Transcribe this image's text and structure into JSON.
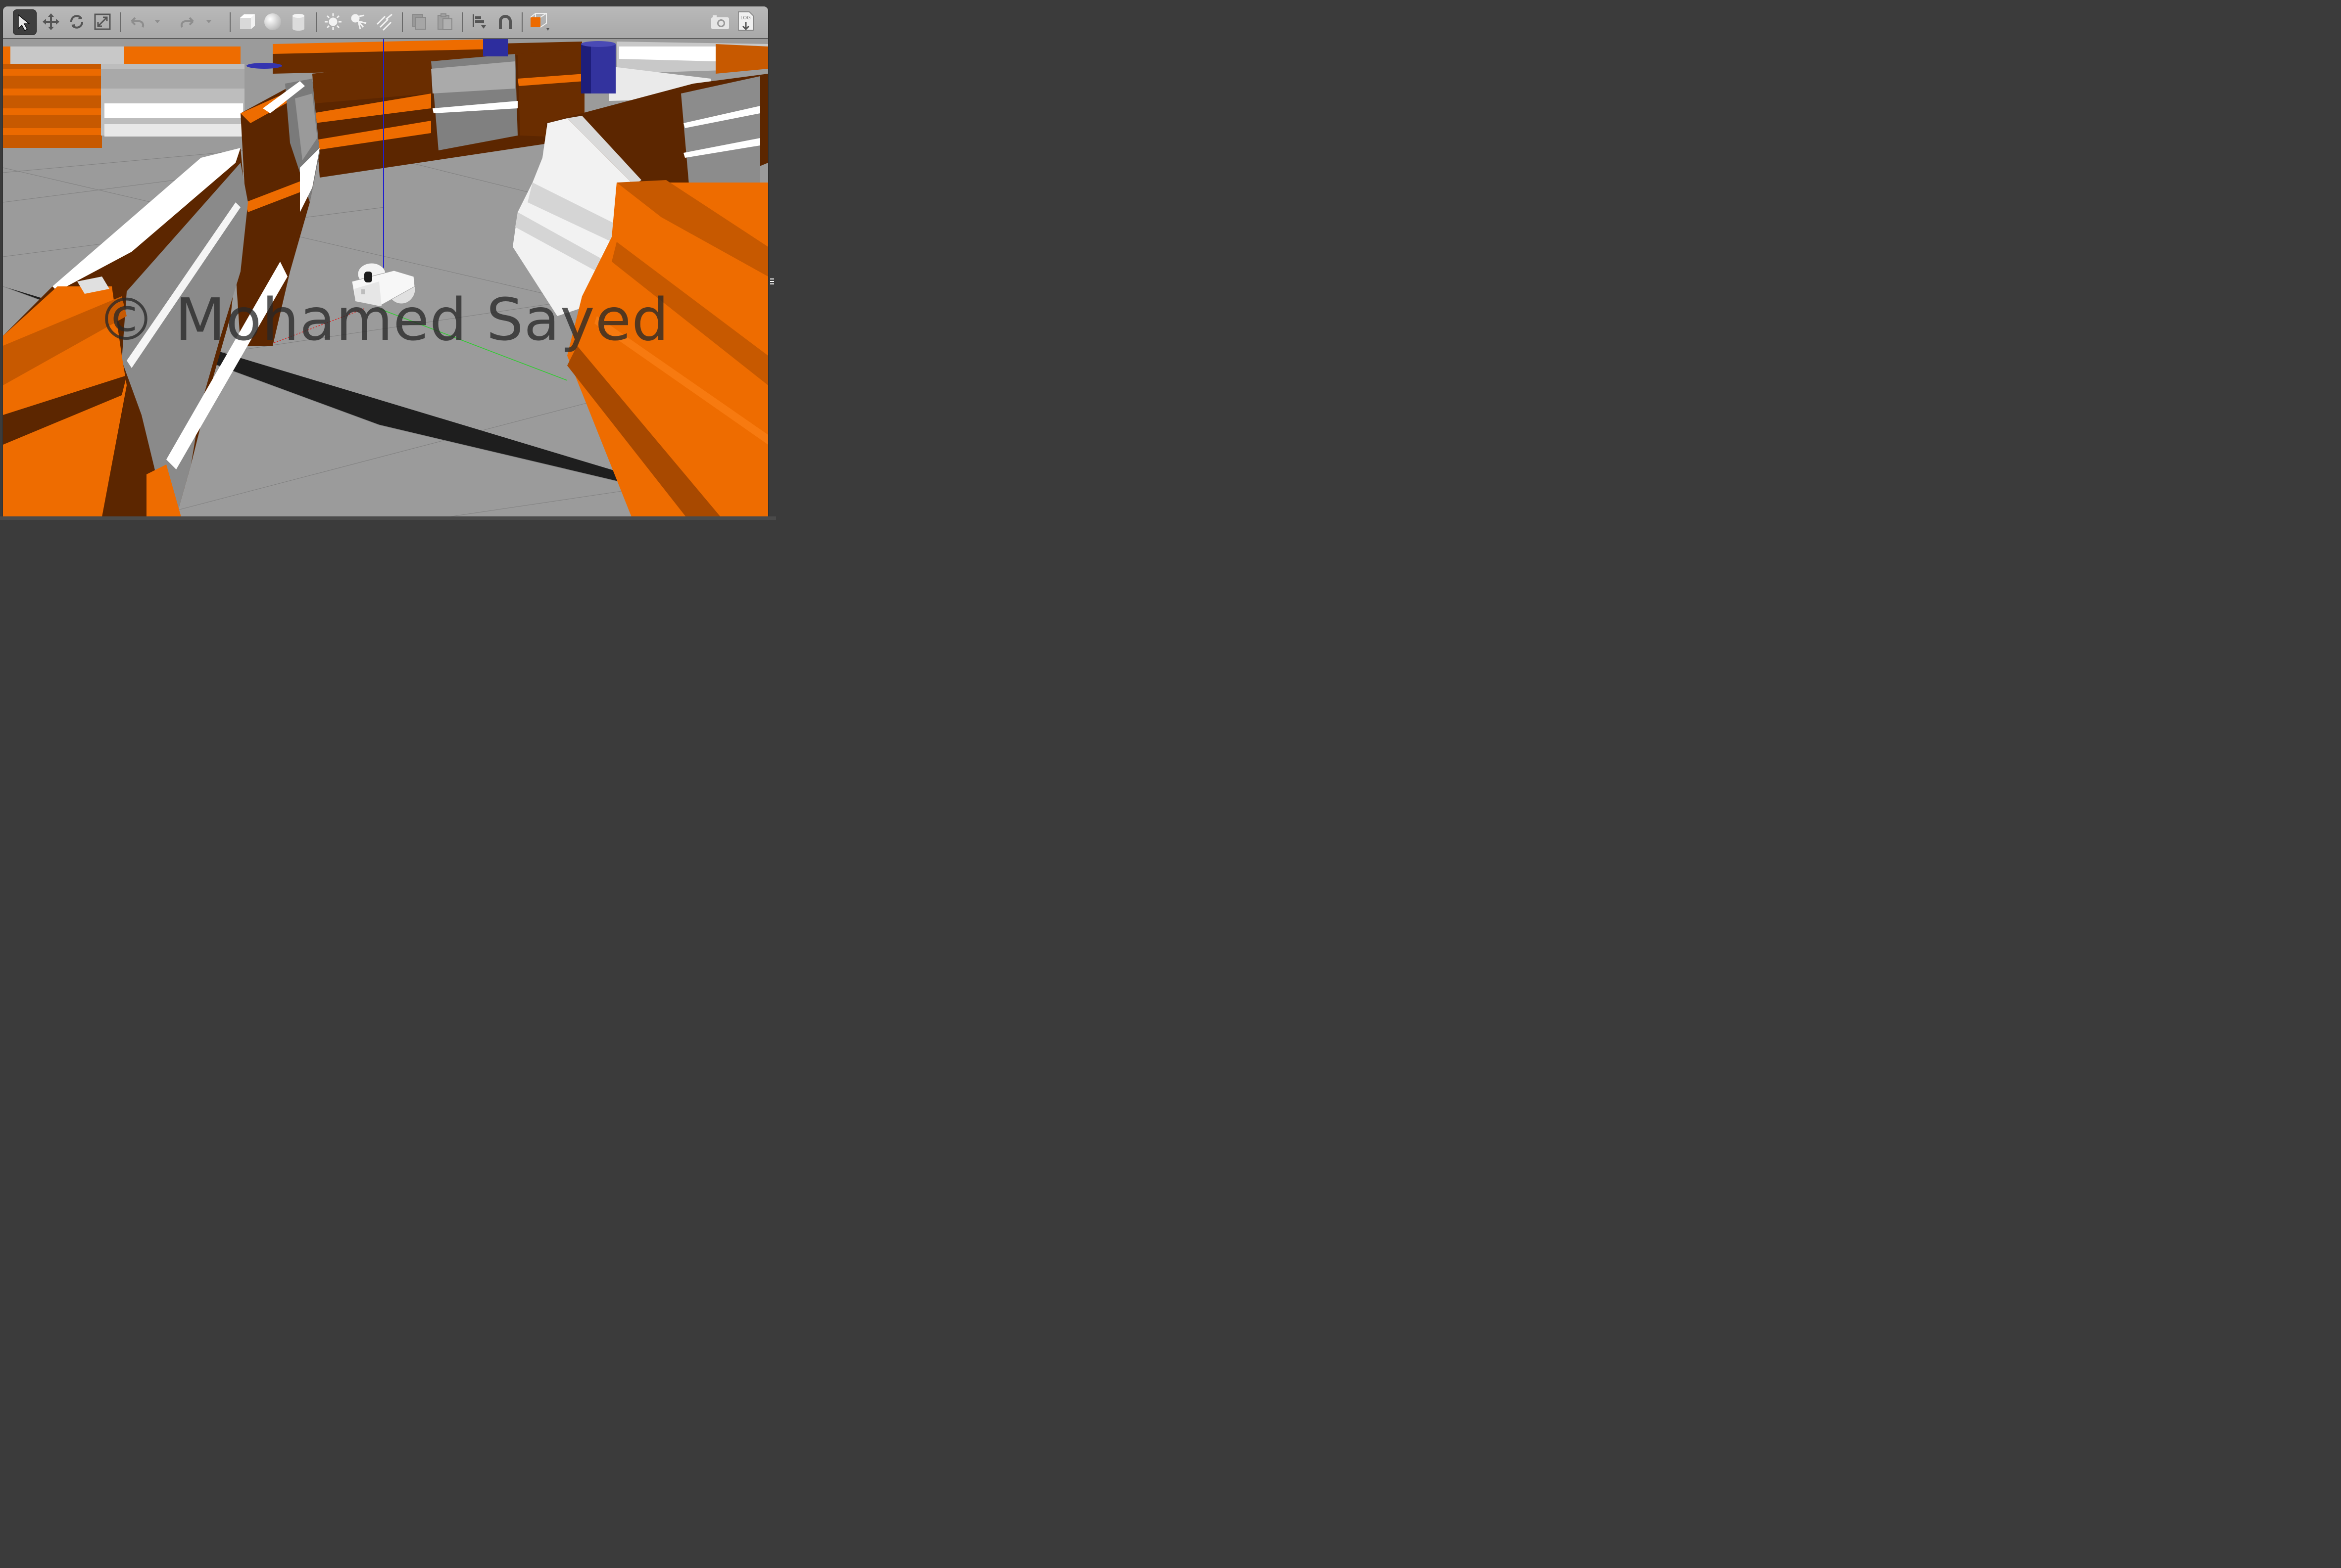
{
  "toolbar": {
    "tools": [
      {
        "name": "select-mode-icon",
        "active": true
      },
      {
        "name": "translate-mode-icon"
      },
      {
        "name": "rotate-mode-icon"
      },
      {
        "name": "scale-mode-icon"
      },
      {
        "name": "undo-icon"
      },
      {
        "name": "undo-dropdown-icon"
      },
      {
        "name": "redo-icon"
      },
      {
        "name": "redo-dropdown-icon"
      },
      {
        "name": "box-shape-icon"
      },
      {
        "name": "sphere-shape-icon"
      },
      {
        "name": "cylinder-shape-icon"
      },
      {
        "name": "point-light-icon"
      },
      {
        "name": "spot-light-icon"
      },
      {
        "name": "directional-light-icon"
      },
      {
        "name": "copy-icon"
      },
      {
        "name": "paste-icon"
      },
      {
        "name": "align-icon"
      },
      {
        "name": "snap-magnet-icon"
      },
      {
        "name": "view-angle-icon"
      },
      {
        "name": "screenshot-camera-icon"
      },
      {
        "name": "log-icon"
      }
    ],
    "log_label": "LOG"
  },
  "viewport": {
    "watermark": "© Mohamed Sayed"
  },
  "colors": {
    "barrier_orange": "#ec6a00",
    "barrier_dark": "#5c2600",
    "barrier_white": "#f3f3f3",
    "ground": "#9a9a9a",
    "cylinder_blue": "#2d2d9e",
    "toolbar_bg": "#b3b3b3"
  }
}
